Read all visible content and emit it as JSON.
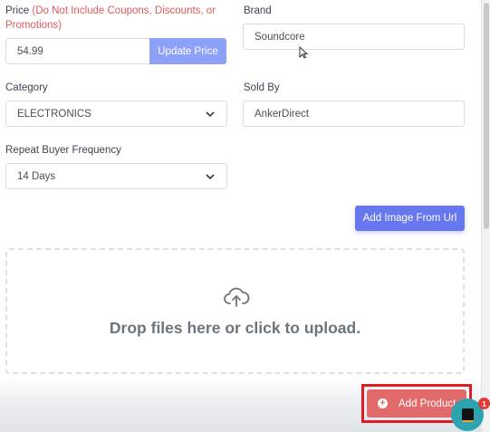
{
  "price": {
    "label": "Price",
    "note": "(Do Not Include Coupons, Discounts, or Promotions)",
    "value": "54.99",
    "update_button": "Update Price"
  },
  "brand": {
    "label": "Brand",
    "value": "Soundcore"
  },
  "category": {
    "label": "Category",
    "value": "ELECTRONICS",
    "icon": "chevron-down-icon"
  },
  "sold_by": {
    "label": "Sold By",
    "value": "AnkerDirect"
  },
  "repeat_buyer": {
    "label": "Repeat Buyer Frequency",
    "value": "14 Days",
    "icon": "chevron-down-icon"
  },
  "add_image_button": "Add Image From Url",
  "dropzone": {
    "text": "Drop files here or click to upload.",
    "icon": "cloud-upload-icon"
  },
  "add_product_button": "Add Product",
  "chat": {
    "badge_count": "1",
    "icon": "chat-icon"
  },
  "colors": {
    "primary": "#6777ef",
    "primary_light": "#8ea1f8",
    "danger": "#e26a6a",
    "warning_text": "#e05a5a",
    "highlight_border": "#e01b24",
    "chat": "#2ea3b0"
  }
}
